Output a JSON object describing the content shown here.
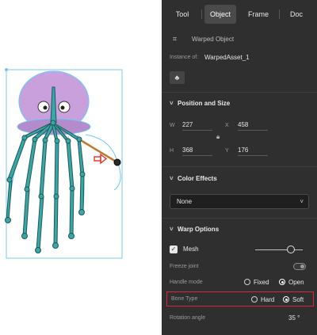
{
  "tabs": [
    {
      "label": "Tool",
      "active": false
    },
    {
      "label": "Object",
      "active": true
    },
    {
      "label": "Frame",
      "active": false
    },
    {
      "label": "Doc",
      "active": false
    }
  ],
  "object": {
    "icon": "warped-object-icon",
    "name": "Warped Object",
    "instance_label": "Instance of:",
    "instance_value": "WarpedAsset_1",
    "swap_icon": "swap-symbol-icon"
  },
  "position_size": {
    "title": "Position and Size",
    "w_label": "W",
    "w_value": "227",
    "x_label": "X",
    "x_value": "458",
    "h_label": "H",
    "h_value": "368",
    "y_label": "Y",
    "y_value": "176",
    "lock_icon": "lock-icon"
  },
  "color_effects": {
    "title": "Color Effects",
    "selected": "None"
  },
  "warp_options": {
    "title": "Warp Options",
    "mesh_label": "Mesh",
    "mesh_checked": true,
    "mesh_level": 0.8,
    "freeze_label": "Freeze joint",
    "freeze_on": false,
    "handle_label": "Handle mode",
    "handle_options": [
      "Fixed",
      "Open"
    ],
    "handle_selected": "Open",
    "bone_label": "Bone Type",
    "bone_options": [
      "Hard",
      "Soft"
    ],
    "bone_selected": "Soft",
    "rotation_label": "Rotation angle",
    "rotation_value": "35 °"
  },
  "colors": {
    "panel_bg": "#2f2f2f",
    "highlight": "#d7263d",
    "jelly_head": "#c9a0dc",
    "bone": "#3aa6a6",
    "selection": "#6ec6ff",
    "handle_arrow": "#e0342b"
  }
}
